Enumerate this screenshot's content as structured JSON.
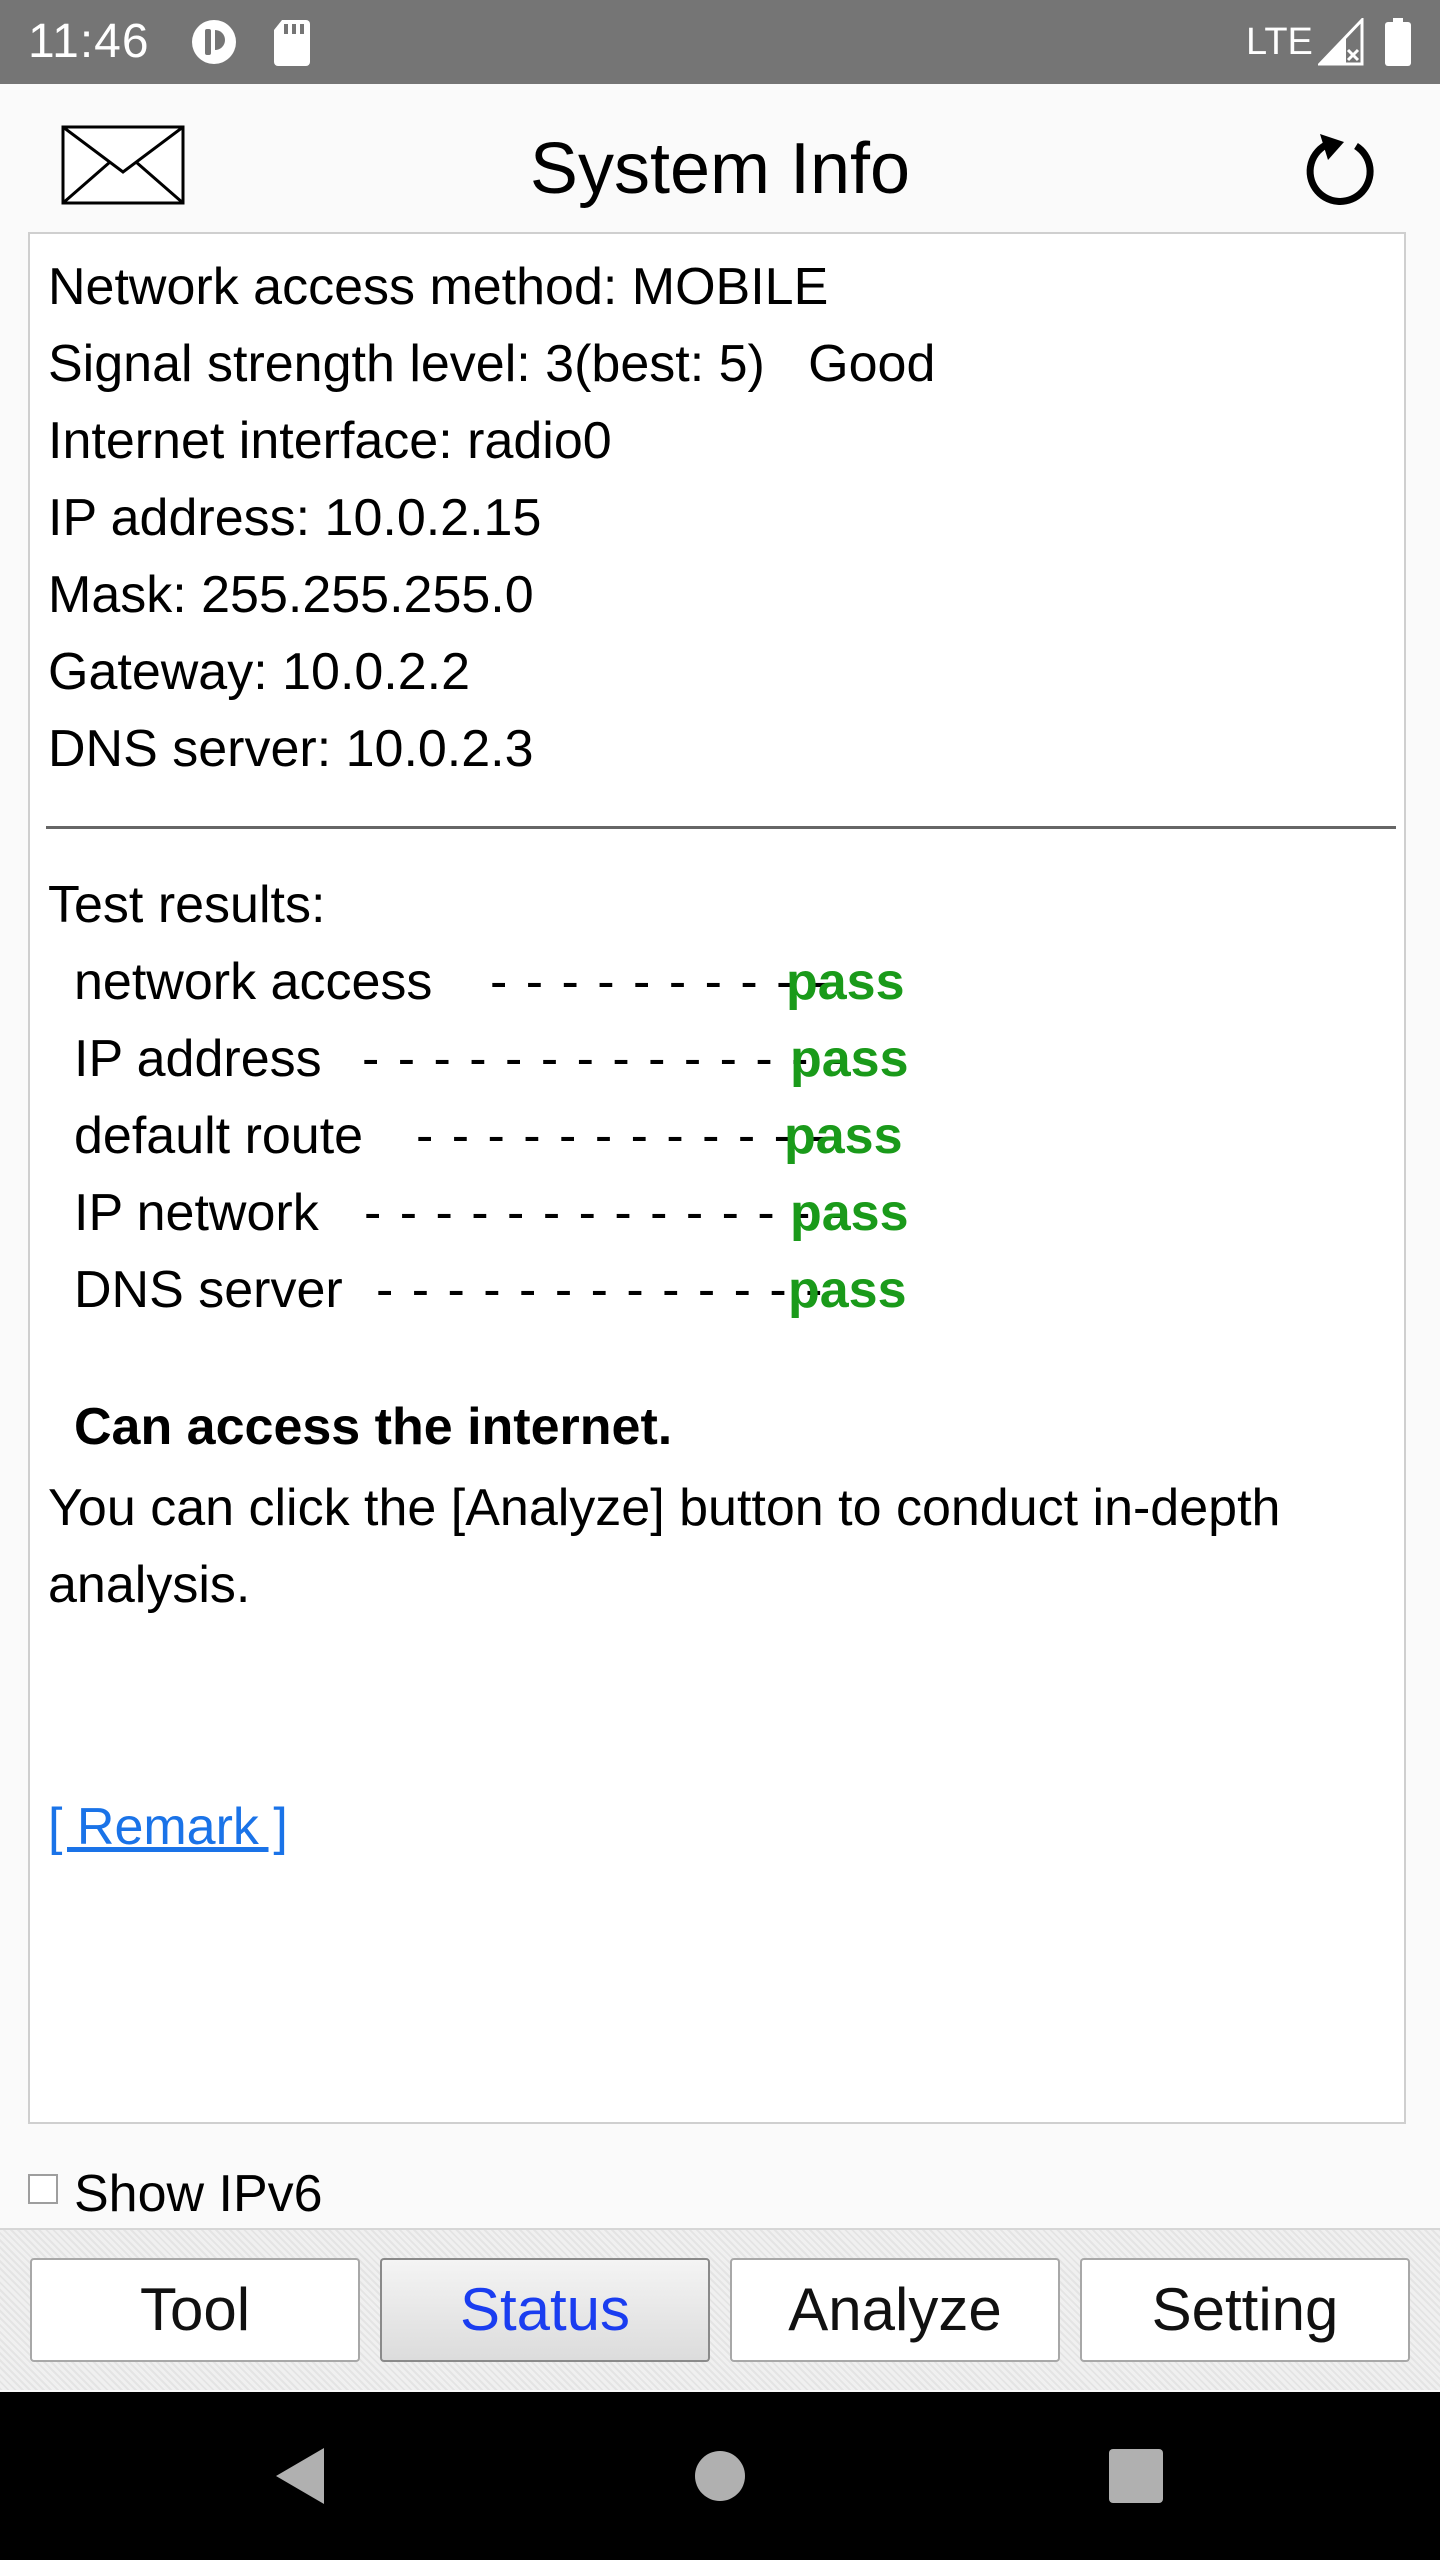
{
  "status_bar": {
    "time": "11:46",
    "network_label": "LTE",
    "icons": [
      "sync-icon",
      "sd-card-icon",
      "signal-icon",
      "battery-icon"
    ]
  },
  "header": {
    "title": "System Info",
    "left_icon": "mail-icon",
    "right_icon": "refresh-icon"
  },
  "info": [
    "Network access method: MOBILE",
    "Signal strength level: 3(best: 5)   Good",
    "Internet interface: radio0",
    "IP address: 10.0.2.15",
    "Mask: 255.255.255.0",
    "Gateway: 10.0.2.2",
    "DNS server: 10.0.2.3"
  ],
  "tests": {
    "heading": "Test results:",
    "items": [
      {
        "label": "network access",
        "dashes": "- - - - - - - - - -",
        "result": "pass"
      },
      {
        "label": "IP address",
        "dashes": "- - - - - - - - - - - - - -",
        "result": "pass"
      },
      {
        "label": "default route",
        "dashes": "- - - - - - - - - - - -",
        "result": "pass"
      },
      {
        "label": "IP network",
        "dashes": "- - - - - - - - - - - - - -",
        "result": "pass"
      },
      {
        "label": "DNS server",
        "dashes": "- - - - - - - - - - - - -",
        "result": "pass"
      }
    ],
    "pass_color": "#1a9a1a"
  },
  "conclusion": "Can access the internet.",
  "hint": "You can click the [Analyze] button to conduct in-depth analysis.",
  "remark_link": "[ Remark ]",
  "ipv6": {
    "label": "Show IPv6",
    "checked": false
  },
  "tabs": [
    {
      "label": "Tool",
      "active": false
    },
    {
      "label": "Status",
      "active": true
    },
    {
      "label": "Analyze",
      "active": false
    },
    {
      "label": "Setting",
      "active": false
    }
  ],
  "nav": [
    "back-icon",
    "home-icon",
    "recents-icon"
  ],
  "colors": {
    "status_bar": "#757575",
    "active_tab_text": "#1a3df0",
    "link": "#1a73e8"
  }
}
